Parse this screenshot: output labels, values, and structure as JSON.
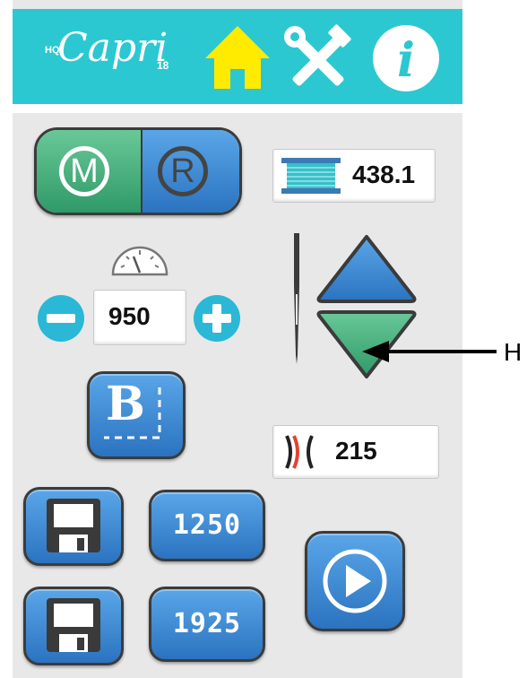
{
  "header": {
    "logo_prefix": "HQ",
    "logo_text": "Capri",
    "logo_suffix": "18",
    "icons": [
      "home-icon",
      "tools-icon",
      "info-icon"
    ],
    "color": "#2cc8d2"
  },
  "mode_toggle": {
    "left_label": "M",
    "right_label": "R"
  },
  "thread_counter": {
    "value": "438.1"
  },
  "speed": {
    "value": "950"
  },
  "stitch_counter": {
    "value": "215"
  },
  "presets": {
    "top": "1250",
    "bottom": "1925"
  },
  "annotation": {
    "label": "H"
  },
  "colors": {
    "blue": "#2b73c0",
    "green": "#2f9a68",
    "accent": "#2cc8d2"
  }
}
